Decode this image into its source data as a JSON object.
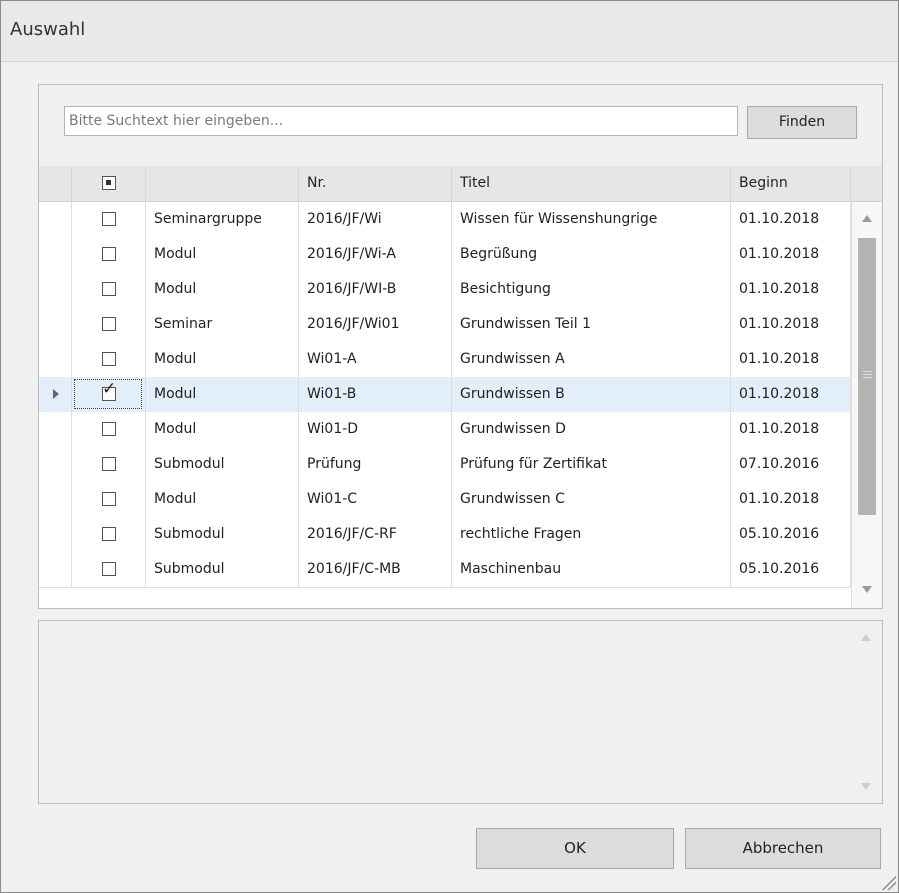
{
  "dialog": {
    "title": "Auswahl"
  },
  "search": {
    "placeholder": "Bitte Suchtext hier eingeben...",
    "value": "",
    "find_label": "Finden"
  },
  "grid": {
    "headers": [
      "",
      "",
      "Nr.",
      "Titel",
      "Beginn"
    ],
    "header_check_state": "indeterminate",
    "rows": [
      {
        "checked": false,
        "selected": false,
        "type": "Seminargruppe",
        "nr": "2016/JF/Wi",
        "title": "Wissen für Wissenshungrige",
        "begin": "01.10.2018"
      },
      {
        "checked": false,
        "selected": false,
        "type": "Modul",
        "nr": "2016/JF/Wi-A",
        "title": "Begrüßung",
        "begin": "01.10.2018"
      },
      {
        "checked": false,
        "selected": false,
        "type": "Modul",
        "nr": "2016/JF/WI-B",
        "title": "Besichtigung",
        "begin": "01.10.2018"
      },
      {
        "checked": false,
        "selected": false,
        "type": "Seminar",
        "nr": "2016/JF/Wi01",
        "title": "Grundwissen Teil 1",
        "begin": "01.10.2018"
      },
      {
        "checked": false,
        "selected": false,
        "type": "Modul",
        "nr": "Wi01-A",
        "title": "Grundwissen A",
        "begin": "01.10.2018"
      },
      {
        "checked": true,
        "selected": true,
        "type": "Modul",
        "nr": "Wi01-B",
        "title": "Grundwissen B",
        "begin": "01.10.2018"
      },
      {
        "checked": false,
        "selected": false,
        "type": "Modul",
        "nr": "Wi01-D",
        "title": "Grundwissen D",
        "begin": "01.10.2018"
      },
      {
        "checked": false,
        "selected": false,
        "type": "Submodul",
        "nr": "Prüfung",
        "title": "Prüfung für Zertifikat",
        "begin": "07.10.2016"
      },
      {
        "checked": false,
        "selected": false,
        "type": "Modul",
        "nr": "Wi01-C",
        "title": "Grundwissen C",
        "begin": "01.10.2018"
      },
      {
        "checked": false,
        "selected": false,
        "type": "Submodul",
        "nr": "2016/JF/C-RF",
        "title": "rechtliche Fragen",
        "begin": "05.10.2016"
      },
      {
        "checked": false,
        "selected": false,
        "type": "Submodul",
        "nr": "2016/JF/C-MB",
        "title": "Maschinenbau",
        "begin": "05.10.2016"
      }
    ]
  },
  "memo": {
    "value": ""
  },
  "buttons": {
    "ok": "OK",
    "cancel": "Abbrechen"
  },
  "icons": {
    "checked_mark": "✓"
  }
}
